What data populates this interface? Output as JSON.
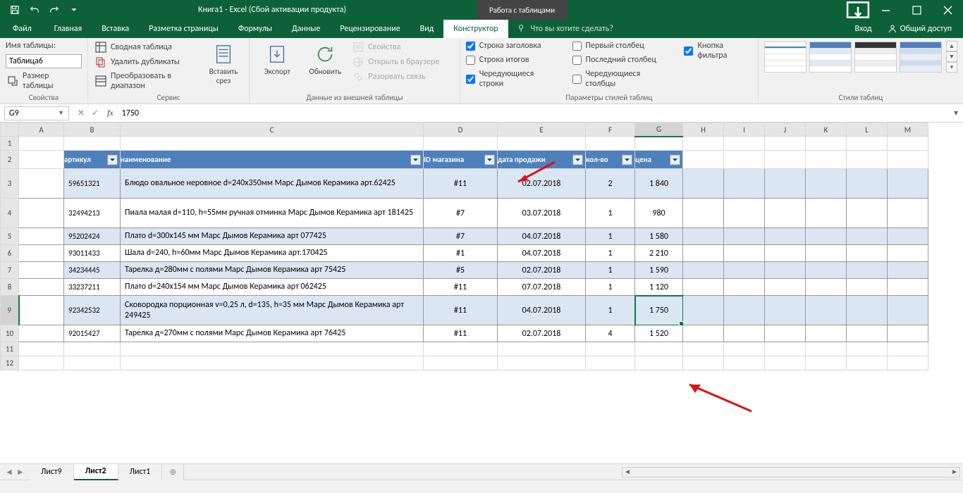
{
  "title": "Книга1 - Excel (Сбой активации продукта)",
  "tabletools_title": "Работа с таблицами",
  "tabs": {
    "file": "Файл",
    "home": "Главная",
    "insert": "Вставка",
    "layout": "Разметка страницы",
    "formulas": "Формулы",
    "data": "Данные",
    "review": "Рецензирование",
    "view": "Вид",
    "design": "Конструктор"
  },
  "tellme": "Что вы хотите сделать?",
  "signin": "Вход",
  "share": "Общий доступ",
  "ribbon": {
    "props": {
      "tablename_label": "Имя таблицы:",
      "tablename_value": "Таблица6",
      "resize": "Размер таблицы",
      "group": "Свойства"
    },
    "tools": {
      "pivot": "Сводная таблица",
      "dedupe": "Удалить дубликаты",
      "torange": "Преобразовать в диапазон",
      "slicer": "Вставить срез",
      "group": "Сервис"
    },
    "external": {
      "export": "Экспорт",
      "refresh": "Обновить",
      "properties": "Свойства",
      "openbrowser": "Открыть в браузере",
      "unlink": "Разорвать связь",
      "group": "Данные из внешней таблицы"
    },
    "styleopts": {
      "header": "Строка заголовка",
      "total": "Строка итогов",
      "banded_rows": "Чередующиеся строки",
      "first_col": "Первый столбец",
      "last_col": "Последний столбец",
      "banded_cols": "Чередующиеся столбцы",
      "filter": "Кнопка фильтра",
      "group": "Параметры стилей таблиц"
    },
    "styles": {
      "group": "Стили таблиц"
    }
  },
  "namebox": "G9",
  "formula": "1750",
  "columns": [
    "A",
    "B",
    "C",
    "D",
    "E",
    "F",
    "G",
    "H",
    "I",
    "J",
    "K",
    "L",
    "M"
  ],
  "headers": {
    "art": "артикул",
    "name": "наименование",
    "store": "ID магазина",
    "date": "дата продажи",
    "qty": "кол-во",
    "price": "цена"
  },
  "rows": [
    {
      "art": "59651321",
      "name": "Блюдо овальное неровное d=240х350мм Марс Дымов Керамика арт.62425",
      "store": "#11",
      "date": "02.07.2018",
      "qty": "2",
      "price": "1 840"
    },
    {
      "art": "32494213",
      "name": "Пиала малая d=110, h=55мм ручная отминка Марс Дымов Керамика арт 181425",
      "store": "#7",
      "date": "03.07.2018",
      "qty": "1",
      "price": "980"
    },
    {
      "art": "95202424",
      "name": "Плато d=300х145 мм Марс Дымов Керамика арт 077425",
      "store": "#7",
      "date": "04.07.2018",
      "qty": "1",
      "price": "1 580"
    },
    {
      "art": "93011433",
      "name": "Шала d=240, h=60мм  Марс Дымов Керамика арт.170425",
      "store": "#1",
      "date": "04.07.2018",
      "qty": "1",
      "price": "2 210"
    },
    {
      "art": "34234445",
      "name": "Тарелка д=280мм с полями Марс Дымов Керамика арт 75425",
      "store": "#5",
      "date": "02.07.2018",
      "qty": "1",
      "price": "1 590"
    },
    {
      "art": "33237211",
      "name": "Плато d=240х154 мм Марс Дымов Керамика арт 062425",
      "store": "#11",
      "date": "07.07.2018",
      "qty": "1",
      "price": "1 120"
    },
    {
      "art": "92342532",
      "name": "Сковородка порционная v=0,25 л, d=135, h=35 мм Марс Дымов Керамика арт 249425",
      "store": "#11",
      "date": "04.07.2018",
      "qty": "1",
      "price": "1 750"
    },
    {
      "art": "92015427",
      "name": "Тарелка д=270мм с полями Марс Дымов Керамика арт 76425",
      "store": "#11",
      "date": "02.07.2018",
      "qty": "4",
      "price": "1 520"
    }
  ],
  "sheets": {
    "s1": "Лист9",
    "s2": "Лист2",
    "s3": "Лист1"
  }
}
